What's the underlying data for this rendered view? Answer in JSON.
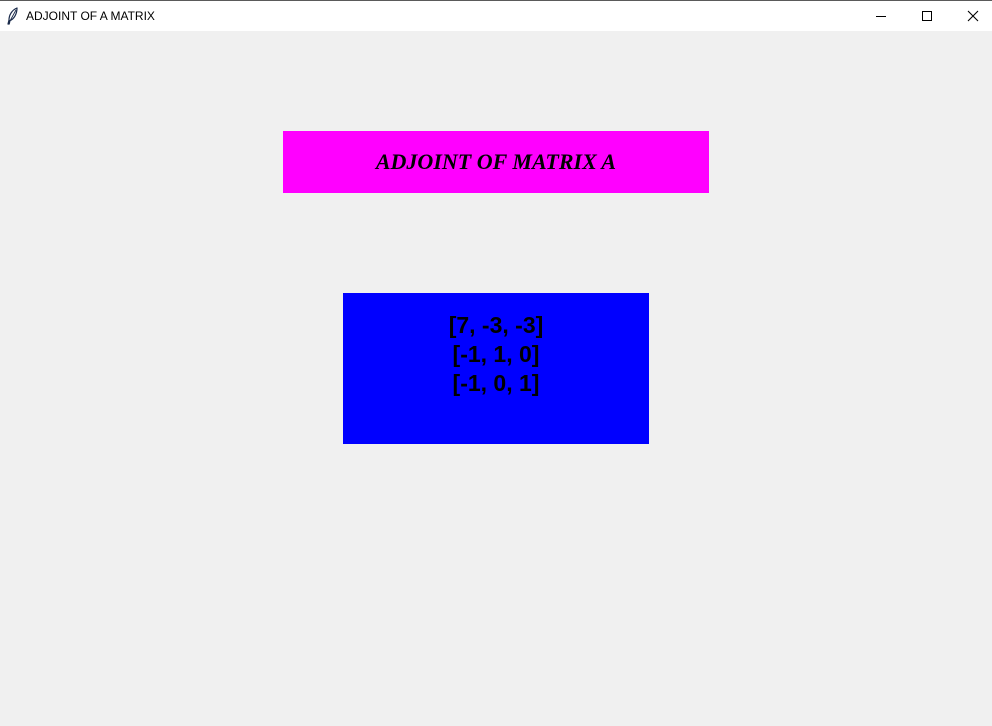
{
  "window": {
    "title": "ADJOINT OF A MATRIX",
    "app_icon": "feather-icon",
    "controls": {
      "minimize_icon": "minimize-icon",
      "maximize_icon": "maximize-icon",
      "close_icon": "close-icon"
    }
  },
  "heading": {
    "text": "ADJOINT OF MATRIX A",
    "background": "#ff00ff"
  },
  "matrix": {
    "background": "#0000ff",
    "rows": [
      "[7, -3, -3]",
      "[-1, 1, 0]",
      "[-1, 0, 1]"
    ]
  }
}
